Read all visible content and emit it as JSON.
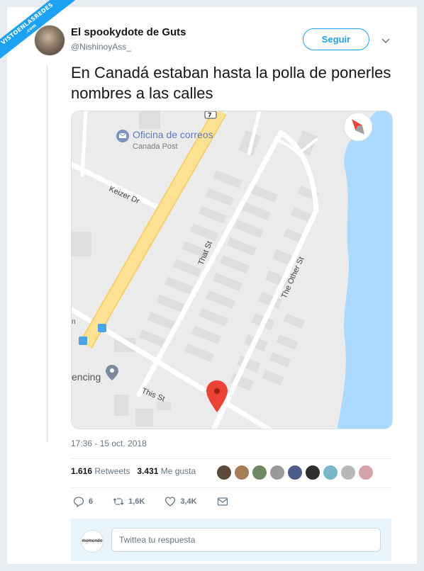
{
  "watermark": {
    "text": "VISTOENLASREDES",
    "sub": ".com"
  },
  "author": {
    "name": "El spookydote de Guts",
    "handle": "@NishinoyAss_"
  },
  "follow_label": "Seguir",
  "tweet_text": "En Canadá estaban hasta la polla de ponerles nombres a las calles",
  "map": {
    "poi_name": "Oficina de correos",
    "poi_sub": "Canada Post",
    "streets": {
      "keizer": "Keizer Dr",
      "that": "That St",
      "other": "The Other St",
      "this": "This St"
    },
    "partial_label": "encing",
    "route_number": "7",
    "colors": {
      "water": "#aadaff",
      "land": "#ebebeb",
      "highway": "#fde293",
      "marker": "#ea4335"
    }
  },
  "timestamp": "17:36 - 15 oct. 2018",
  "stats": {
    "retweets_count": "1.616",
    "retweets_label": "Retweets",
    "likes_count": "3.431",
    "likes_label": "Me gusta"
  },
  "actions": {
    "replies": "6",
    "retweets": "1,6K",
    "likes": "3,4K"
  },
  "reply": {
    "avatar_text": "momondo",
    "placeholder": "Twittea tu respuesta"
  },
  "colors": {
    "brand": "#1da1f2",
    "text": "#14171a",
    "muted": "#657786"
  }
}
